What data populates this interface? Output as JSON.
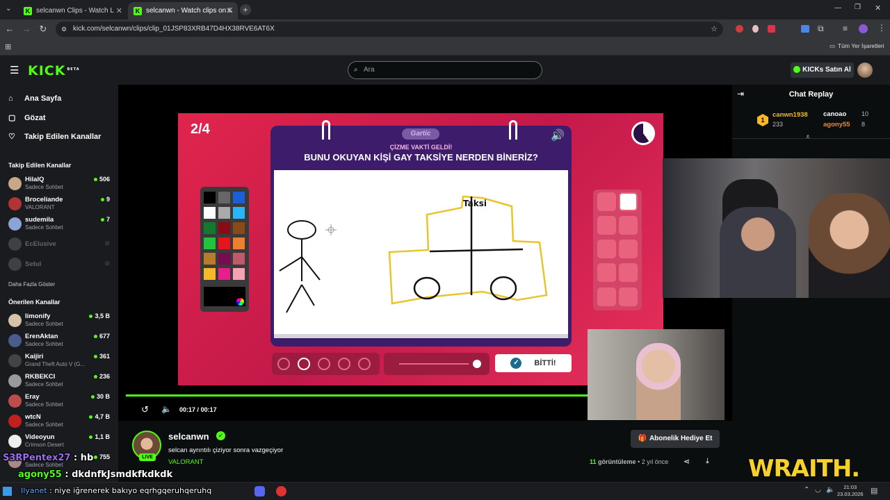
{
  "browser": {
    "tabs": [
      {
        "title": "selcanwn Clips - Watch Live on",
        "active": false
      },
      {
        "title": "selcanwn - Watch clips on Kick",
        "active": true
      }
    ],
    "url": "kick.com/selcanwn/clips/clip_01JSP83XRB47D4HX38RVE6AT6X",
    "bookmarks_label": "Tüm Yer İşaretleri"
  },
  "header": {
    "logo": "KICK",
    "logo_beta": "BETA",
    "search_placeholder": "Ara",
    "kicks_button": "KICKs Satın Al"
  },
  "sidebar": {
    "nav": [
      {
        "label": "Ana Sayfa",
        "icon": "home-icon"
      },
      {
        "label": "Gözat",
        "icon": "browse-icon"
      },
      {
        "label": "Takip Edilen Kanallar",
        "icon": "heart-icon"
      }
    ],
    "followed_heading": "Takip Edilen Kanallar",
    "followed": [
      {
        "name": "HilalQ",
        "sub": "Sadece Sohbet",
        "viewers": "506",
        "color": "#c9a88a"
      },
      {
        "name": "Broceliande",
        "sub": "VALORANT",
        "viewers": "9",
        "color": "#b03434"
      },
      {
        "name": "sudemila",
        "sub": "Sadece Sohbet",
        "viewers": "7",
        "color": "#8aa4d6"
      },
      {
        "name": "EcElusive",
        "sub": "",
        "viewers": "",
        "color": "#777"
      },
      {
        "name": "Setul",
        "sub": "",
        "viewers": "",
        "color": "#777"
      }
    ],
    "show_more": "Daha Fazla Göster",
    "recommended_heading": "Önerilen Kanallar",
    "recommended": [
      {
        "name": "limonify",
        "sub": "Sadece Sohbet",
        "viewers": "3,5 B",
        "color": "#d7c3a9"
      },
      {
        "name": "ErenAktan",
        "sub": "Sadece Sohbet",
        "viewers": "677",
        "color": "#4a5c8c"
      },
      {
        "name": "Kaijiri",
        "sub": "Grand Theft Auto V (G...",
        "viewers": "361",
        "color": "#444"
      },
      {
        "name": "RKBEKCI",
        "sub": "Sadece Sohbet",
        "viewers": "236",
        "color": "#9a9a9a"
      },
      {
        "name": "Eray",
        "sub": "Sadece Sohbet",
        "viewers": "30 B",
        "color": "#bd4d4d"
      },
      {
        "name": "wtcN",
        "sub": "Sadece Sohbet",
        "viewers": "4,7 B",
        "color": "#c02020"
      },
      {
        "name": "Videoyun",
        "sub": "Crimson Desert",
        "viewers": "1,1 B",
        "color": "#eeeeee"
      },
      {
        "name": "",
        "sub": "Sadece Sohbet",
        "viewers": "755",
        "color": "#a88"
      }
    ]
  },
  "game": {
    "round": "2/4",
    "brand": "Gartic",
    "prompt_header": "ÇİZME VAKTİ GELDİ!",
    "prompt": "BUNU OKUYAN KİŞİ GAY TAKSİYE NERDEN BİNERİZ?",
    "drawing_text": "Taksi",
    "done_button": "BİTTİ!",
    "palette": [
      "#000000",
      "#666666",
      "#1a5fd6",
      "#ffffff",
      "#aaaaaa",
      "#2ab6f6",
      "#127a2b",
      "#8a0b14",
      "#8a4a17",
      "#21c43b",
      "#e8141b",
      "#ee7f30",
      "#b87b2a",
      "#7a0b52",
      "#c05a6a",
      "#f5b82a",
      "#e81f8b",
      "#f5a3b3"
    ]
  },
  "player": {
    "time_current": "00:17",
    "time_separator": "/",
    "time_total": "00:17",
    "progress": 1.0
  },
  "chat": {
    "title": "Chat Replay",
    "leaderboard": [
      {
        "rank": "1",
        "name": "canwn1938",
        "score": "233"
      },
      {
        "name": "canoao",
        "score": "10"
      },
      {
        "name": "agony55",
        "score": "8"
      }
    ]
  },
  "stream": {
    "channel": "selcanwn",
    "live_badge": "LIVE",
    "title": "selcan ayrıntılı çiziyor sonra vazgeçiyor",
    "category": "VALORANT",
    "views": "11",
    "views_label": "görüntüleme",
    "time_ago": "2 yıl önce",
    "gift_button": "Abonelik Hediye Et"
  },
  "overlay_chat": [
    {
      "user": "S3RPentex27",
      "text": "hb"
    },
    {
      "user": "agony55",
      "text": "dkdnfkJsmdkfkdkdk"
    },
    {
      "user": "Ilyanet",
      "text": "niye iğrenerek bakıyo eqrhgqeruhqeruhq"
    }
  ],
  "overlay_brand": "WRAITH.",
  "taskbar": {
    "time": "21:03",
    "date": "23.03.2026"
  }
}
